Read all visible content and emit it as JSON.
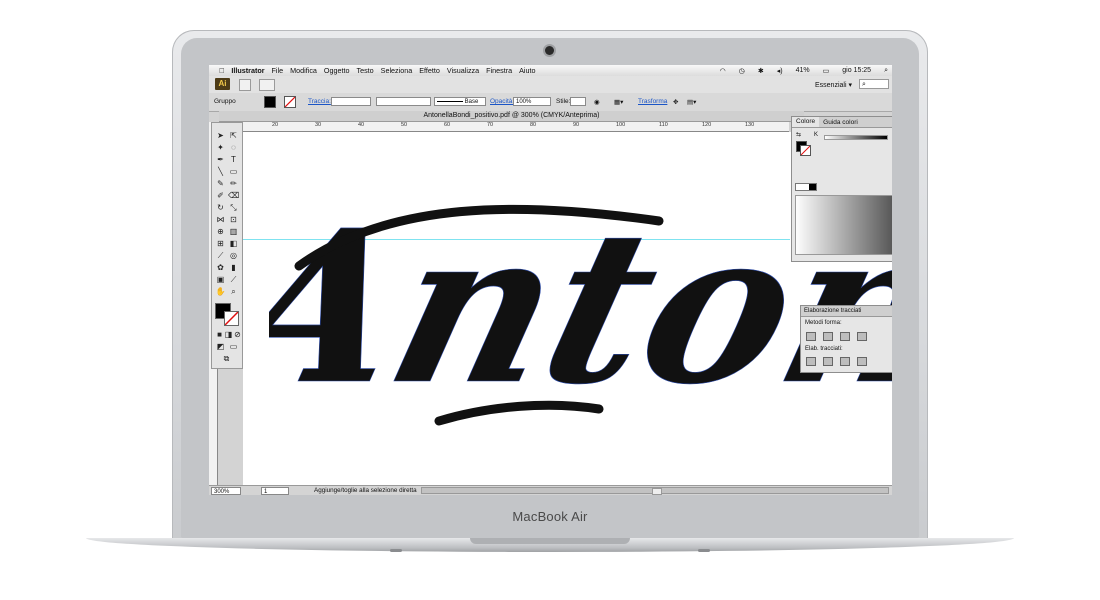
{
  "device": {
    "brand": "MacBook Air"
  },
  "menubar": {
    "apple_icon": "apple-icon",
    "items": [
      "Illustrator",
      "File",
      "Modifica",
      "Oggetto",
      "Testo",
      "Seleziona",
      "Effetto",
      "Visualizza",
      "Finestra",
      "Aiuto"
    ],
    "battery": "41%",
    "clock": "gio 15:25"
  },
  "app_bar": {
    "logo": "Ai",
    "workspace": "Essenziali",
    "workspace_arrow": "▾"
  },
  "control_bar": {
    "selection": "Gruppo",
    "stroke_label": "Traccia:",
    "brush_label": "Base",
    "opacity_label": "Opacità:",
    "opacity_value": "100%",
    "style_label": "Stile:",
    "transform_label": "Trasforma"
  },
  "document": {
    "title": "AntonellaBondi_positivo.pdf @ 300% (CMYK/Anteprima)"
  },
  "ruler": {
    "ticks": [
      "20",
      "30",
      "40",
      "50",
      "60",
      "70",
      "80",
      "90",
      "100",
      "110",
      "120",
      "130"
    ]
  },
  "artwork": {
    "text": "Antonella"
  },
  "color_panel": {
    "tabs": [
      "Colore",
      "Guida colori"
    ],
    "channel": "K"
  },
  "pathfinder_panel": {
    "title": "Elaborazione tracciati",
    "shape_modes_label": "Metodi forma:",
    "pathfinders_label": "Elab. tracciati:"
  },
  "status_bar": {
    "zoom": "300%",
    "artboard": "1",
    "status_text": "Aggiunge/toglie alla selezione diretta"
  },
  "colors": {
    "guide": "#7fe3f0",
    "ink": "#111111",
    "menubar_highlight": "#f2c94c"
  }
}
